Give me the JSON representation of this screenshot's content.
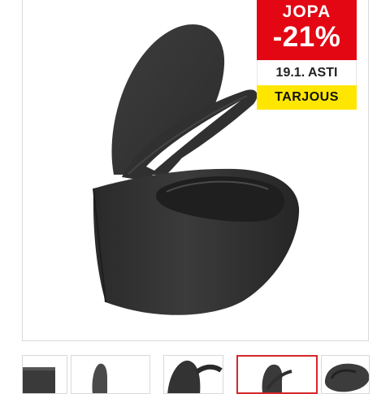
{
  "product": {
    "image_icon": "wall-hung-toilet-image"
  },
  "badge": {
    "line1": "JOPA",
    "discount": "-21%",
    "until": "19.1. ASTI",
    "tag": "TARJOUS",
    "colors": {
      "red": "#e30613",
      "yellow": "#ffe600"
    }
  },
  "gallery": {
    "thumbnails": [
      {
        "label": "thumbnail-1",
        "active": false
      },
      {
        "label": "thumbnail-2",
        "active": false
      },
      {
        "label": "thumbnail-3",
        "active": false
      },
      {
        "label": "thumbnail-4",
        "active": true
      },
      {
        "label": "thumbnail-5",
        "active": false
      }
    ],
    "active_border_color": "#d7262b"
  }
}
